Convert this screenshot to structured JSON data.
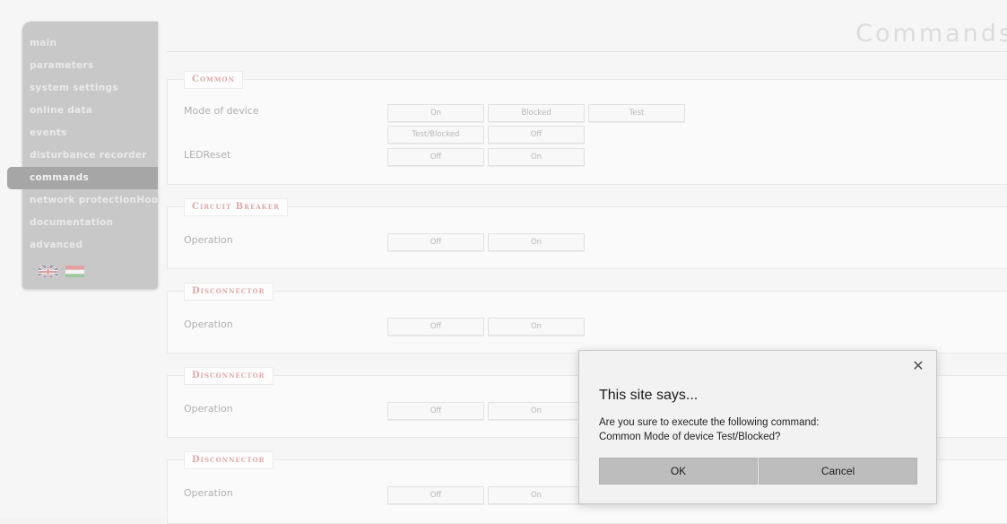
{
  "sidebar": {
    "items": [
      {
        "label": "main",
        "active": false
      },
      {
        "label": "parameters",
        "active": false
      },
      {
        "label": "system settings",
        "active": false
      },
      {
        "label": "online data",
        "active": false
      },
      {
        "label": "events",
        "active": false
      },
      {
        "label": "disturbance recorder",
        "active": false
      },
      {
        "label": "commands",
        "active": true
      },
      {
        "label": "network protectionHood",
        "active": false
      },
      {
        "label": "documentation",
        "active": false
      },
      {
        "label": "advanced",
        "active": false
      }
    ],
    "flags": [
      "uk-flag-icon",
      "hungary-flag-icon"
    ]
  },
  "page": {
    "title": "Commands"
  },
  "sections": [
    {
      "legend": "Common",
      "rows": [
        {
          "label": "Mode of device",
          "buttons": [
            "On",
            "Blocked",
            "Test"
          ]
        },
        {
          "label": "",
          "buttons": [
            "Test/Blocked",
            "Off"
          ]
        },
        {
          "label": "LEDReset",
          "buttons": [
            "Off",
            "On"
          ]
        }
      ]
    },
    {
      "legend": "Circuit Breaker",
      "rows": [
        {
          "label": "Operation",
          "buttons": [
            "Off",
            "On"
          ]
        }
      ]
    },
    {
      "legend": "Disconnector",
      "rows": [
        {
          "label": "Operation",
          "buttons": [
            "Off",
            "On"
          ]
        }
      ]
    },
    {
      "legend": "Disconnector",
      "rows": [
        {
          "label": "Operation",
          "buttons": [
            "Off",
            "On"
          ]
        }
      ]
    },
    {
      "legend": "Disconnector",
      "rows": [
        {
          "label": "Operation",
          "buttons": [
            "Off",
            "On"
          ]
        }
      ]
    }
  ],
  "dialog": {
    "heading": "This site says...",
    "message_line1": "Are you sure to execute the following command:",
    "message_line2": "Common Mode of device Test/Blocked?",
    "ok_label": "OK",
    "cancel_label": "Cancel",
    "close_icon": "close-icon"
  },
  "colors": {
    "sidebar_bg": "#c8c8c8",
    "sidebar_active": "#a6a6a6",
    "legend_text": "#e0a8a8",
    "dialog_bg": "#f2f2f2",
    "dialog_button": "#bdbdbd"
  }
}
